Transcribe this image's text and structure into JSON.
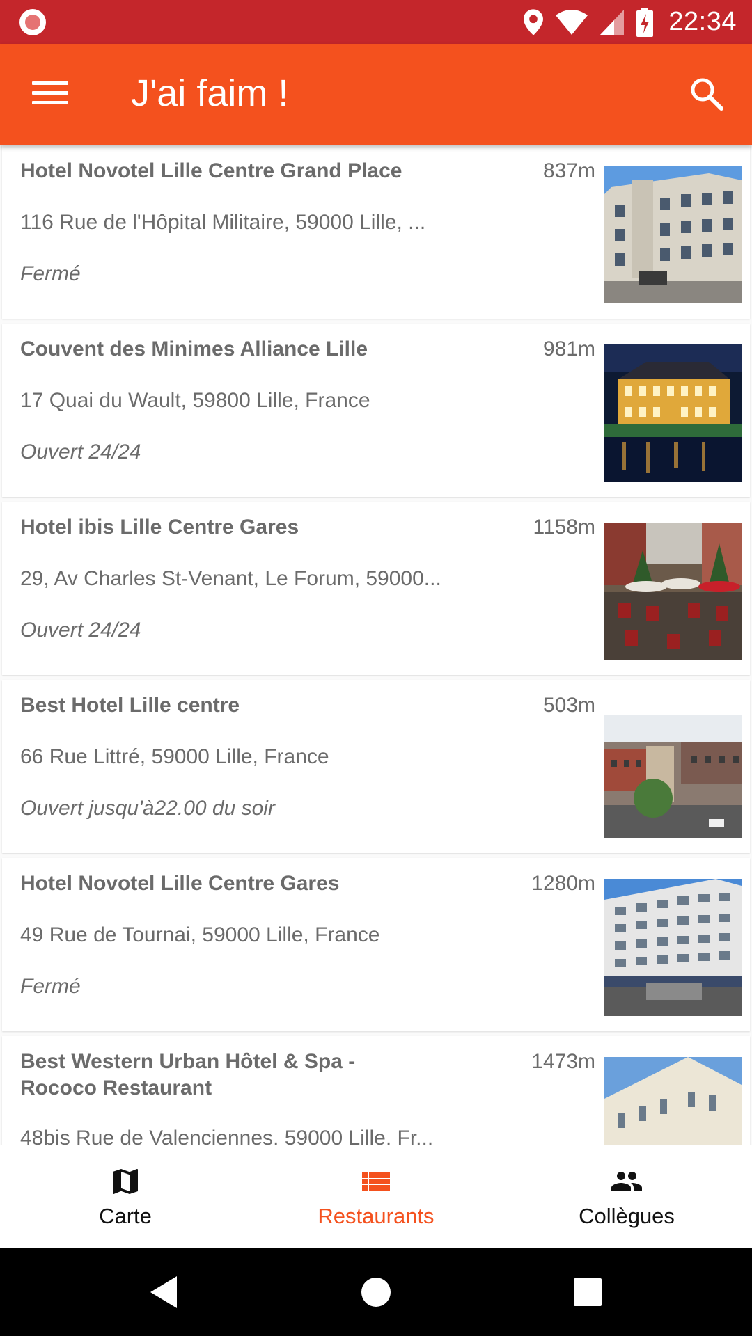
{
  "status_bar": {
    "time": "22:34",
    "icons": [
      "screen-record-icon",
      "location-icon",
      "wifi-icon",
      "signal-icon",
      "battery-charging-icon"
    ]
  },
  "app_bar": {
    "title": "J'ai faim !",
    "menu_icon": "menu-icon",
    "search_icon": "search-icon"
  },
  "restaurants": [
    {
      "name": "Hotel Novotel Lille Centre Grand Place",
      "distance": "837m",
      "address": "116 Rue de l'Hôpital Militaire, 59000 Lille, ...",
      "status": "Fermé"
    },
    {
      "name": "Couvent des Minimes Alliance Lille",
      "distance": "981m",
      "address": "17 Quai du Wault, 59800 Lille, France",
      "status": "Ouvert 24/24"
    },
    {
      "name": "Hotel ibis Lille Centre Gares",
      "distance": "1158m",
      "address": "29, Av Charles St-Venant, Le Forum, 59000...",
      "status": "Ouvert 24/24"
    },
    {
      "name": "Best Hotel Lille centre",
      "distance": "503m",
      "address": "66 Rue Littré, 59000 Lille, France",
      "status": "Ouvert jusqu'à22.00 du soir"
    },
    {
      "name": "Hotel Novotel Lille Centre Gares",
      "distance": "1280m",
      "address": "49 Rue de Tournai, 59000 Lille, France",
      "status": "Fermé"
    },
    {
      "name": "Best Western Urban Hôtel & Spa - Rococo Restaurant",
      "distance": "1473m",
      "address": "48bis Rue de Valenciennes, 59000 Lille, Fr...",
      "status": ""
    }
  ],
  "bottom_nav": {
    "items": [
      {
        "label": "Carte",
        "icon": "map-icon",
        "active": false
      },
      {
        "label": "Restaurants",
        "icon": "list-icon",
        "active": true
      },
      {
        "label": "Collègues",
        "icon": "people-icon",
        "active": false
      }
    ]
  },
  "system_nav": {
    "icons": [
      "back-icon",
      "home-icon",
      "recents-icon"
    ]
  },
  "colors": {
    "status_bar": "#c4262b",
    "app_bar": "#f4511e",
    "accent": "#f4511e",
    "text_secondary": "#6b6b6b"
  }
}
